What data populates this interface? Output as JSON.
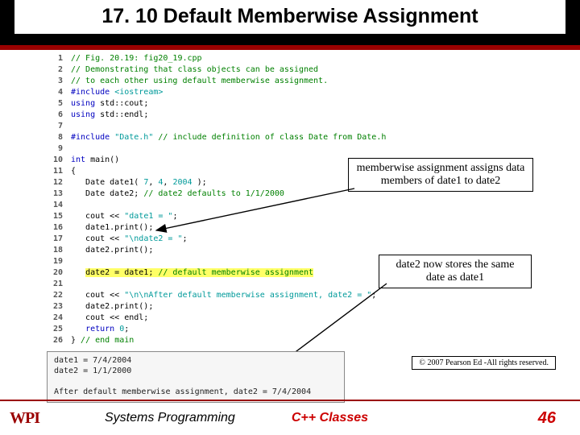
{
  "title": "17. 10 Default Memberwise Assignment",
  "code": [
    {
      "n": 1,
      "html": "<span class='cmt'>// Fig. 20.19: fig20_19.cpp</span>"
    },
    {
      "n": 2,
      "html": "<span class='cmt'>// Demonstrating that class objects can be assigned</span>"
    },
    {
      "n": 3,
      "html": "<span class='cmt'>// to each other using default memberwise assignment.</span>"
    },
    {
      "n": 4,
      "html": "<span class='pre'>#include </span><span class='str'>&lt;iostream&gt;</span>"
    },
    {
      "n": 5,
      "html": "<span class='kwd'>using</span> std::cout;"
    },
    {
      "n": 6,
      "html": "<span class='kwd'>using</span> std::endl;"
    },
    {
      "n": 7,
      "html": ""
    },
    {
      "n": 8,
      "html": "<span class='pre'>#include </span><span class='str'>\"Date.h\"</span> <span class='cmt'>// include definition of class Date from Date.h</span>"
    },
    {
      "n": 9,
      "html": ""
    },
    {
      "n": 10,
      "html": "<span class='kwd'>int</span> main()"
    },
    {
      "n": 11,
      "html": "{"
    },
    {
      "n": 12,
      "html": "   Date date1( <span class='num'>7</span>, <span class='num'>4</span>, <span class='num'>2004</span> );"
    },
    {
      "n": 13,
      "html": "   Date date2; <span class='cmt'>// date2 defaults to 1/1/2000</span>"
    },
    {
      "n": 14,
      "html": ""
    },
    {
      "n": 15,
      "html": "   cout &lt;&lt; <span class='str'>\"date1 = \"</span>;"
    },
    {
      "n": 16,
      "html": "   date1.print();"
    },
    {
      "n": 17,
      "html": "   cout &lt;&lt; <span class='str'>\"\\ndate2 = \"</span>;"
    },
    {
      "n": 18,
      "html": "   date2.print();"
    },
    {
      "n": 19,
      "html": ""
    },
    {
      "n": 20,
      "html": "   <span class='hl'>date2 = date1; <span class='cmt'>// default memberwise assignment</span></span>"
    },
    {
      "n": 21,
      "html": ""
    },
    {
      "n": 22,
      "html": "   cout &lt;&lt; <span class='str'>\"\\n\\nAfter default memberwise assignment, date2 = \"</span>;"
    },
    {
      "n": 23,
      "html": "   date2.print();"
    },
    {
      "n": 24,
      "html": "   cout &lt;&lt; endl;"
    },
    {
      "n": 25,
      "html": "   <span class='kwd'>return</span> <span class='num'>0</span>;"
    },
    {
      "n": 26,
      "html": "} <span class='cmt'>// end main</span>"
    }
  ],
  "output": {
    "line1": "date1 = 7/4/2004",
    "line2": "date2 = 1/1/2000",
    "line3": "",
    "line4": "After default memberwise assignment, date2 = 7/4/2004"
  },
  "callouts": {
    "c1": "memberwise assignment assigns data members of date1 to date2",
    "c2": "date2 now stores the same date as date1"
  },
  "copyright": "© 2007 Pearson Ed -All rights reserved.",
  "footer": {
    "logo": "WPI",
    "left": "Systems Programming",
    "mid": "C++ Classes",
    "page": "46"
  }
}
